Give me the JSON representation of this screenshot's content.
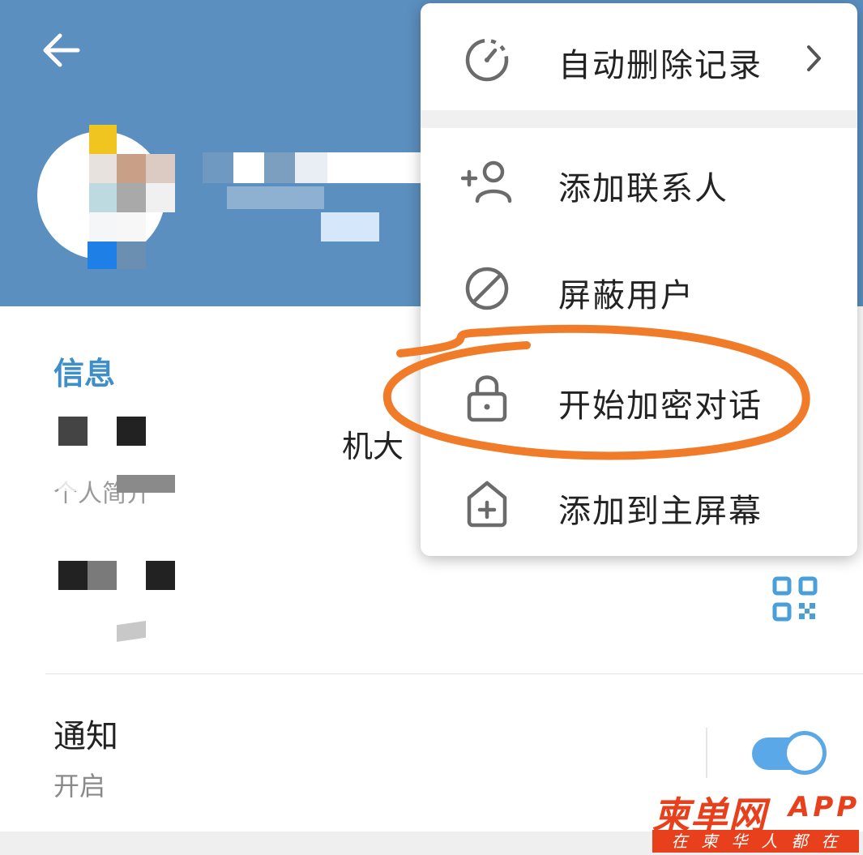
{
  "colors": {
    "header_bg": "#5b8fbf",
    "accent": "#3d8ec9",
    "toggle": "#5aa8e8",
    "annotation": "#f07c2a",
    "watermark": "#e8401c"
  },
  "header": {
    "back_icon": "arrow-left-icon"
  },
  "info": {
    "section_title": "信息",
    "bio_partial": "机大",
    "bio_label": "个人简介",
    "qr_icon": "qr-code-icon"
  },
  "notifications": {
    "title": "通知",
    "status": "开启",
    "enabled": true
  },
  "menu": {
    "items": [
      {
        "label": "自动删除记录",
        "icon": "timer-icon",
        "has_submenu": true
      },
      {
        "label": "添加联系人",
        "icon": "add-user-icon"
      },
      {
        "label": "屏蔽用户",
        "icon": "block-icon"
      },
      {
        "label": "开始加密对话",
        "icon": "lock-icon"
      },
      {
        "label": "添加到主屏幕",
        "icon": "home-add-icon"
      }
    ]
  },
  "watermark": {
    "brand": "柬单网",
    "app": "APP",
    "slogan": "在柬华人都在用"
  }
}
